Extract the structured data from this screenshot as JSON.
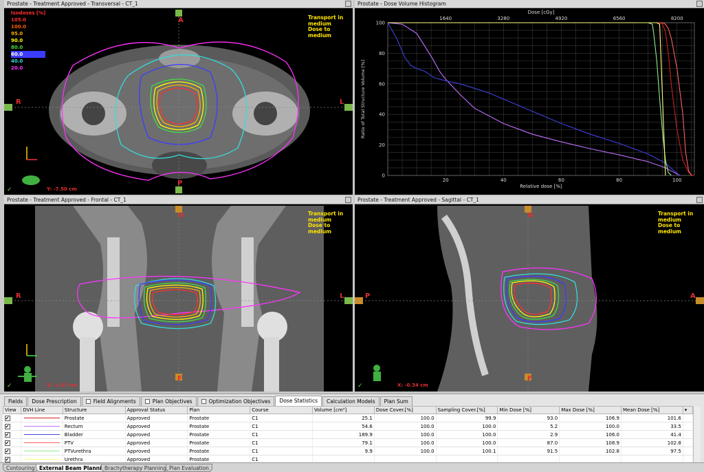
{
  "views": {
    "transversal": {
      "title": "Prostate  -  Treatment Approved - Transversal - CT_1",
      "labels": {
        "top": "A",
        "bottom": "P",
        "left": "R",
        "right": "L"
      },
      "coord": "Y: -7.50 cm"
    },
    "frontal": {
      "title": "Prostate  -  Treatment Approved - Frontal - CT_1",
      "labels": {
        "top": "H",
        "bottom": "F",
        "left": "R",
        "right": "L"
      },
      "coord": "Z: -1.07 cm"
    },
    "sagittal": {
      "title": "Prostate  -  Treatment Approved - Sagittal - CT_1",
      "labels": {
        "top": "H",
        "bottom": "F",
        "left": "P",
        "right": "A"
      },
      "coord": "X: -0.34 cm"
    },
    "dvh": {
      "title": "Prostate  -  Dose Volume Histogram"
    }
  },
  "transport_note": [
    "Transport in",
    "medium",
    "Dose to medium"
  ],
  "isodose_legend": {
    "title": "Isodoses [%]",
    "levels": [
      {
        "value": "105.0",
        "color": "#ff3030"
      },
      {
        "value": "100.0",
        "color": "#ff5a00"
      },
      {
        "value": "95.0",
        "color": "#ffb000"
      },
      {
        "value": "90.0",
        "color": "#ffff00"
      },
      {
        "value": "80.0",
        "color": "#44dd44"
      },
      {
        "value": "60.0",
        "color": "#3c3cff"
      },
      {
        "value": "40.0",
        "color": "#33dddd"
      },
      {
        "value": "20.0",
        "color": "#ff33ff"
      }
    ]
  },
  "chart_data": {
    "type": "line",
    "title": "",
    "xlabel": "Relative dose [%]",
    "ylabel": "Ratio of Total Structure Volume [%]",
    "x2label": "Dose [cGy]",
    "xlim": [
      0,
      106
    ],
    "ylim": [
      0,
      100
    ],
    "x_ticks": [
      20,
      40,
      60,
      80,
      100
    ],
    "y_ticks": [
      0,
      20,
      40,
      60,
      80,
      100
    ],
    "x2_ticks": [
      "1640",
      "3280",
      "4920",
      "6560",
      "8200"
    ],
    "grid": true,
    "series": [
      {
        "name": "Prostate",
        "color": "#d02020",
        "x": [
          0,
          94,
          95,
          96,
          97,
          98,
          100,
          102,
          104,
          105,
          106
        ],
        "y": [
          100,
          100,
          99,
          94,
          80,
          60,
          30,
          10,
          2,
          0.3,
          0
        ]
      },
      {
        "name": "Rectum",
        "color": "#c070ff",
        "x": [
          0,
          5,
          10,
          15,
          18,
          20,
          25,
          30,
          40,
          50,
          60,
          70,
          80,
          90,
          96,
          99,
          101
        ],
        "y": [
          100,
          99,
          93,
          78,
          68,
          63,
          53,
          44,
          34,
          27,
          22,
          17.5,
          13.5,
          9,
          5,
          2,
          0
        ]
      },
      {
        "name": "Bladder",
        "color": "#4040e0",
        "x": [
          0,
          3,
          6,
          8,
          10,
          13,
          16,
          20,
          25,
          30,
          35,
          40,
          50,
          60,
          70,
          80,
          90,
          96,
          99,
          101
        ],
        "y": [
          100,
          90,
          77,
          72,
          70,
          68,
          64,
          62,
          60,
          57,
          54,
          50,
          42,
          34,
          27,
          21,
          14,
          8,
          3,
          0
        ]
      },
      {
        "name": "PTV",
        "color": "#ff6060",
        "x": [
          0,
          95,
          96,
          97,
          98,
          100,
          102,
          103,
          104,
          105
        ],
        "y": [
          100,
          100,
          99,
          96,
          90,
          70,
          40,
          15,
          3,
          0
        ]
      },
      {
        "name": "PTVurethra",
        "color": "#90ee90",
        "x": [
          0,
          90,
          91.5,
          92,
          93,
          94,
          95,
          96,
          97,
          98
        ],
        "y": [
          100,
          100,
          99,
          92,
          75,
          50,
          28,
          10,
          2,
          0
        ]
      },
      {
        "name": "Urethra",
        "color": "#ffff80",
        "x": [
          0,
          93,
          94,
          95,
          96
        ],
        "y": [
          100,
          100,
          99,
          50,
          0
        ]
      }
    ]
  },
  "panel": {
    "tabs": [
      {
        "label": "Fields",
        "checkbox": false,
        "active": false
      },
      {
        "label": "Dose Prescription",
        "checkbox": false,
        "active": false
      },
      {
        "label": "Field Alignments",
        "checkbox": true,
        "active": false
      },
      {
        "label": "Plan Objectives",
        "checkbox": true,
        "active": false
      },
      {
        "label": "Optimization Objectives",
        "checkbox": true,
        "active": false
      },
      {
        "label": "Dose Statistics",
        "checkbox": false,
        "active": true
      },
      {
        "label": "Calculation Models",
        "checkbox": false,
        "active": false
      },
      {
        "label": "Plan Sum",
        "checkbox": false,
        "active": false
      }
    ],
    "columns": [
      "View",
      "DVH Line",
      "Structure",
      "Approval Status",
      "Plan",
      "Course",
      "Volume [cm³]",
      "Dose Cover.[%]",
      "Sampling Cover.[%]",
      "Min Dose [%]",
      "Max Dose [%]",
      "Mean Dose [%]"
    ],
    "rows": [
      {
        "view": "✔",
        "line_color": "#d02020",
        "structure": "Prostate",
        "approval": "Approved",
        "plan": "Prostate",
        "course": "C1",
        "volume": "25.1",
        "dose_cover": "100.0",
        "sampling_cover": "99.9",
        "min": "93.0",
        "max": "106.9",
        "mean": "101.6"
      },
      {
        "view": "✔",
        "line_color": "#c070ff",
        "structure": "Rectum",
        "approval": "Approved",
        "plan": "Prostate",
        "course": "C1",
        "volume": "54.6",
        "dose_cover": "100.0",
        "sampling_cover": "100.0",
        "min": "5.2",
        "max": "100.0",
        "mean": "33.5"
      },
      {
        "view": "✔",
        "line_color": "#4040e0",
        "structure": "Bladder",
        "approval": "Approved",
        "plan": "Prostate",
        "course": "C1",
        "volume": "189.9",
        "dose_cover": "100.0",
        "sampling_cover": "100.0",
        "min": "2.9",
        "max": "106.0",
        "mean": "41.4"
      },
      {
        "view": "✔",
        "line_color": "#ff6060",
        "structure": "PTV",
        "approval": "Approved",
        "plan": "Prostate",
        "course": "C1",
        "volume": "79.1",
        "dose_cover": "100.0",
        "sampling_cover": "100.0",
        "min": "87.0",
        "max": "108.9",
        "mean": "102.8"
      },
      {
        "view": "✔",
        "line_color": "#90ee90",
        "structure": "PTVurethra",
        "approval": "Approved",
        "plan": "Prostate",
        "course": "C1",
        "volume": "9.9",
        "dose_cover": "100.0",
        "sampling_cover": "100.1",
        "min": "91.5",
        "max": "102.8",
        "mean": "97.5"
      },
      {
        "view": "✔",
        "line_color": "#ffff80",
        "structure": "Urethra",
        "approval": "Approved",
        "plan": "Prostate",
        "course": "C1",
        "volume": "",
        "dose_cover": "",
        "sampling_cover": "",
        "min": "",
        "max": "",
        "mean": ""
      }
    ]
  },
  "workspaces": [
    {
      "label": "Contouring",
      "active": false
    },
    {
      "label": "External Beam Planning",
      "active": true
    },
    {
      "label": "Brachytherapy Planning",
      "active": false
    },
    {
      "label": "Plan Evaluation",
      "active": false
    }
  ]
}
